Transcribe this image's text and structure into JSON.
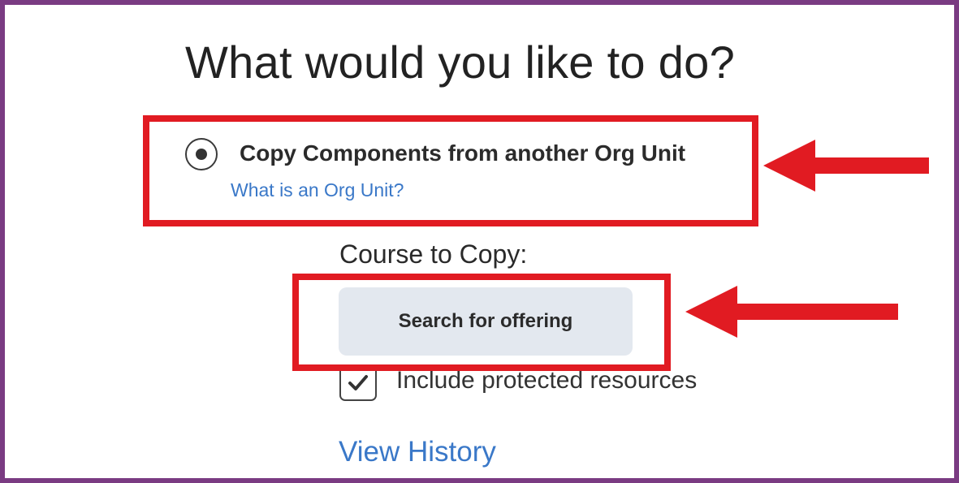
{
  "heading": "What would you like to do?",
  "option": {
    "label": "Copy Components from another Org Unit",
    "selected": true,
    "help_link": "What is an Org Unit?"
  },
  "course": {
    "label": "Course to Copy:",
    "search_button": "Search for offering"
  },
  "protected_resources": {
    "label": "Include protected resources",
    "checked": true
  },
  "history_link": "View History",
  "colors": {
    "frame": "#7a3b82",
    "annotation": "#e11b22",
    "link": "#3a78c8",
    "button_bg": "#e3e8ef"
  },
  "icons": {
    "radio": "radio-selected-icon",
    "checkbox": "checkmark-icon",
    "arrow": "left-arrow-icon"
  }
}
